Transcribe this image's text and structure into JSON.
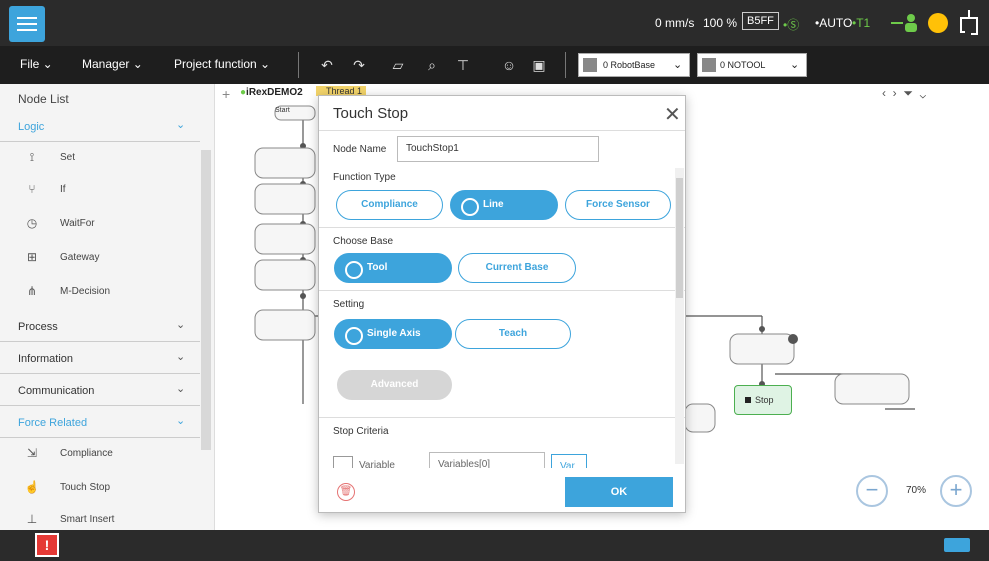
{
  "status_bar": {
    "speed": "0 mm/s",
    "percent": "100 %",
    "code": "B5FF",
    "mode_indicators": [
      "•Ⓢ",
      "•AUTO",
      "•T1"
    ]
  },
  "menu_bar": {
    "file": "File",
    "manager": "Manager",
    "project_function": "Project function",
    "base_select": "0 RobotBase",
    "tool_select": "0 NOTOOL"
  },
  "node_list": {
    "title": "Node List",
    "sections": [
      {
        "label": "Logic",
        "active": true,
        "items": [
          {
            "label": "Set",
            "icon": "set-icon"
          },
          {
            "label": "If",
            "icon": "if-icon"
          },
          {
            "label": "WaitFor",
            "icon": "waitfor-icon"
          },
          {
            "label": "Gateway",
            "icon": "gateway-icon"
          },
          {
            "label": "M-Decision",
            "icon": "m-decision-icon"
          }
        ]
      },
      {
        "label": "Process",
        "active": false
      },
      {
        "label": "Information",
        "active": false
      },
      {
        "label": "Communication",
        "active": false
      },
      {
        "label": "Force Related",
        "active": true,
        "items": [
          {
            "label": "Compliance",
            "icon": "compliance-icon"
          },
          {
            "label": "Touch Stop",
            "icon": "touch-stop-icon"
          },
          {
            "label": "Smart Insert",
            "icon": "smart-insert-icon"
          }
        ]
      }
    ]
  },
  "canvas": {
    "project_tab": "iRexDEMO2",
    "thread_tab": "Thread 1",
    "start_label": "Start",
    "stop_label": "Stop",
    "zoom": "70%"
  },
  "modal": {
    "title": "Touch Stop",
    "node_name_label": "Node Name",
    "node_name_value": "TouchStop1",
    "function_type_label": "Function Type",
    "function_types": [
      "Compliance",
      "Line",
      "Force Sensor"
    ],
    "function_type_selected": "Line",
    "choose_base_label": "Choose Base",
    "bases": [
      "Tool",
      "Current Base"
    ],
    "base_selected": "Tool",
    "setting_label": "Setting",
    "settings": [
      "Single Axis",
      "Teach"
    ],
    "setting_selected": "Single Axis",
    "advanced_label": "Advanced",
    "stop_criteria_label": "Stop Criteria",
    "variable_label": "Variable",
    "variable_value": "Variables[0]",
    "var_button": "Var",
    "ok_label": "OK"
  },
  "colors": {
    "accent": "#3da4dc",
    "topbar": "#2b2b2b",
    "menubar": "#1e1e1e",
    "status_yellow": "#ffc107",
    "alert_red": "#e53935"
  }
}
